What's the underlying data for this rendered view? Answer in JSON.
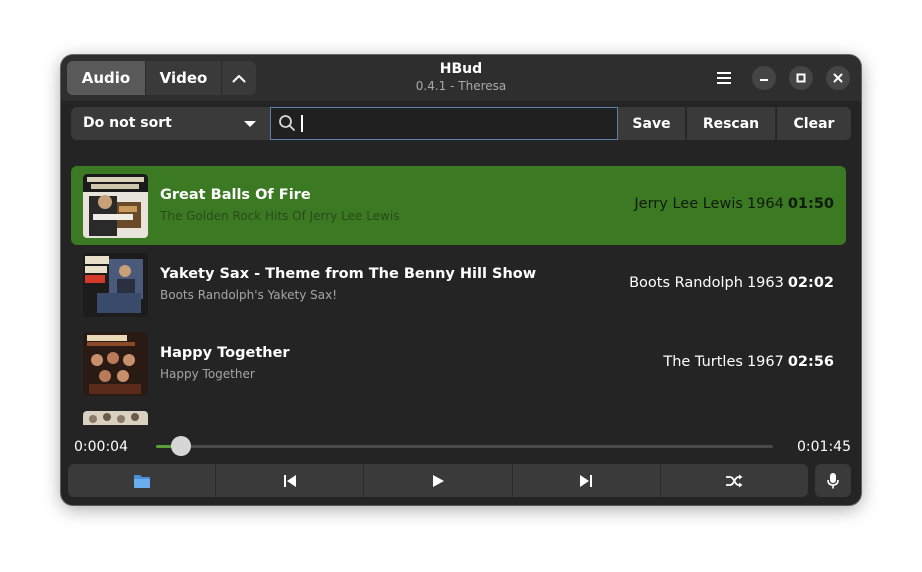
{
  "window": {
    "title": "HBud",
    "subtitle": "0.4.1 - Theresa"
  },
  "header": {
    "tabs": [
      {
        "label": "Audio",
        "selected": true
      },
      {
        "label": "Video",
        "selected": false
      }
    ],
    "collapse_icon": "chevron-up-icon",
    "menu_icon": "hamburger-menu-icon",
    "window_controls": [
      "minimize-icon",
      "maximize-icon",
      "close-icon"
    ]
  },
  "toolbar": {
    "sort_value": "Do not sort",
    "search_value": "",
    "save_label": "Save",
    "rescan_label": "Rescan",
    "clear_label": "Clear"
  },
  "tracks": [
    {
      "title": "Great Balls Of Fire",
      "album": "The Golden Rock Hits Of Jerry Lee Lewis",
      "artist": "Jerry Lee Lewis",
      "year": "1964",
      "duration": "01:50",
      "active": true
    },
    {
      "title": "Yakety Sax - Theme from The Benny Hill Show",
      "album": "Boots Randolph's Yakety Sax!",
      "artist": "Boots Randolph",
      "year": "1963",
      "duration": "02:02",
      "active": false
    },
    {
      "title": "Happy Together",
      "album": "Happy Together",
      "artist": "The Turtles",
      "year": "1967",
      "duration": "02:56",
      "active": false
    }
  ],
  "player": {
    "current_time": "0:00:04",
    "total_time": "0:01:45",
    "progress_fraction": 0.04
  },
  "controls": [
    "folder-icon",
    "previous-icon",
    "play-icon",
    "next-icon",
    "shuffle-icon",
    "microphone-icon"
  ],
  "colors": {
    "active_row": "#3b7a22",
    "accent_border": "#5c7fae",
    "window_bg": "#242424"
  }
}
